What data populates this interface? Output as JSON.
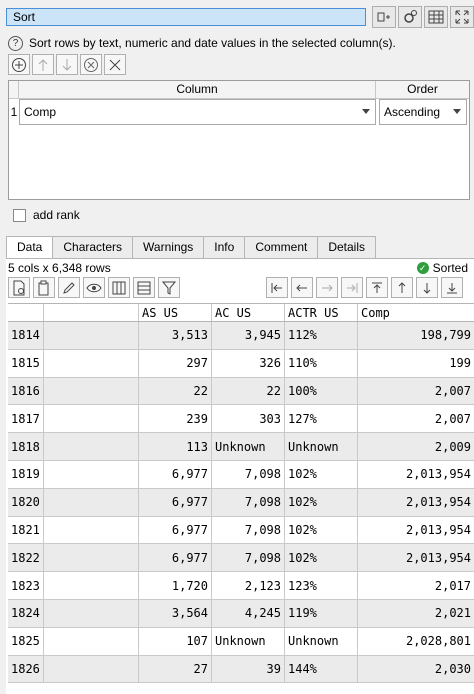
{
  "title": "Sort",
  "help_text": "Sort rows by text, numeric and date values in the selected column(s).",
  "sort_table": {
    "col_header": "Column",
    "order_header": "Order",
    "rows": [
      {
        "num": "1",
        "column": "Comp",
        "order": "Ascending"
      }
    ]
  },
  "add_rank_label": "add rank",
  "tabs": [
    "Data",
    "Characters",
    "Warnings",
    "Info",
    "Comment",
    "Details"
  ],
  "active_tab": "Data",
  "stats": "5 cols x 6,348 rows",
  "sorted_label": "Sorted",
  "grid": {
    "headers": [
      "",
      "",
      "AS US",
      "AC US",
      "ACTR US",
      "Comp"
    ],
    "rows": [
      [
        "1814",
        "",
        "3,513",
        "3,945",
        "112%",
        "198,799"
      ],
      [
        "1815",
        "",
        "297",
        "326",
        "110%",
        "199"
      ],
      [
        "1816",
        "",
        "22",
        "22",
        "100%",
        "2,007"
      ],
      [
        "1817",
        "",
        "239",
        "303",
        "127%",
        "2,007"
      ],
      [
        "1818",
        "",
        "113",
        "Unknown",
        "Unknown",
        "2,009"
      ],
      [
        "1819",
        "",
        "6,977",
        "7,098",
        "102%",
        "2,013,954"
      ],
      [
        "1820",
        "",
        "6,977",
        "7,098",
        "102%",
        "2,013,954"
      ],
      [
        "1821",
        "",
        "6,977",
        "7,098",
        "102%",
        "2,013,954"
      ],
      [
        "1822",
        "",
        "6,977",
        "7,098",
        "102%",
        "2,013,954"
      ],
      [
        "1823",
        "",
        "1,720",
        "2,123",
        "123%",
        "2,017"
      ],
      [
        "1824",
        "",
        "3,564",
        "4,245",
        "119%",
        "2,021"
      ],
      [
        "1825",
        "",
        "107",
        "Unknown",
        "Unknown",
        "2,028,801"
      ],
      [
        "1826",
        "",
        "27",
        "39",
        "144%",
        "2,030"
      ]
    ]
  }
}
